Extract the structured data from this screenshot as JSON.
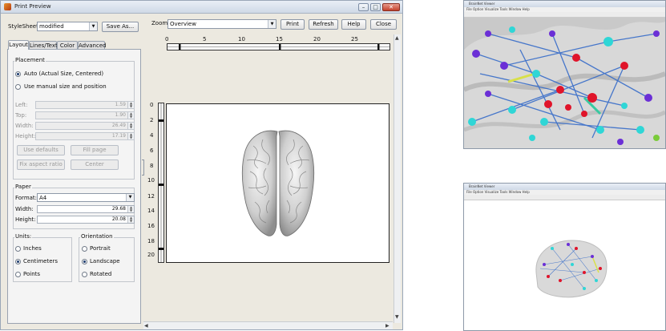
{
  "window": {
    "title": "Print Preview"
  },
  "top": {
    "stylesheet_label": "StyleSheet",
    "stylesheet_value": "modified",
    "save_as_label": "Save As...",
    "zoom_label": "Zoom",
    "zoom_value": "Overview",
    "buttons": {
      "print": "Print",
      "refresh": "Refresh",
      "help": "Help",
      "close": "Close"
    }
  },
  "tabs": [
    "Layout",
    "Lines/Text",
    "Color",
    "Advanced"
  ],
  "placement": {
    "title": "Placement",
    "auto_label": "Auto (Actual Size, Centered)",
    "manual_label": "Use manual size and position",
    "selected": "auto",
    "fields": [
      {
        "label": "Left:",
        "value": "1.59"
      },
      {
        "label": "Top:",
        "value": "1.90"
      },
      {
        "label": "Width:",
        "value": "26.49"
      },
      {
        "label": "Height:",
        "value": "17.19"
      }
    ],
    "buttons": {
      "use_defaults": "Use defaults",
      "fill_page": "Fill page",
      "fix_aspect": "Fix aspect ratio",
      "center": "Center"
    }
  },
  "paper": {
    "title": "Paper",
    "format_label": "Format:",
    "format_value": "A4",
    "width_label": "Width:",
    "width_value": "29.68",
    "height_label": "Height:",
    "height_value": "20.08"
  },
  "units": {
    "title": "Units:",
    "options": [
      "Inches",
      "Centimeters",
      "Points"
    ],
    "selected": "Centimeters"
  },
  "orientation": {
    "title": "Orientation",
    "options": [
      "Portrait",
      "Landscape",
      "Rotated"
    ],
    "selected": "Landscape"
  },
  "ruler": {
    "h_labels": [
      "0",
      "5",
      "10",
      "15",
      "20",
      "25"
    ],
    "v_labels": [
      "0",
      "2",
      "4",
      "6",
      "8",
      "10",
      "12",
      "14",
      "16",
      "18",
      "20"
    ]
  },
  "thumbnails": {
    "title_bar": "BrainNet Viewer",
    "menu": "File  Option  Visualize  Tools  Window  Help"
  },
  "colors": {
    "node_purple": "#6b2fd6",
    "node_cyan": "#2fd6d6",
    "node_red": "#e0142a",
    "edge_blue": "#2d66c8"
  }
}
